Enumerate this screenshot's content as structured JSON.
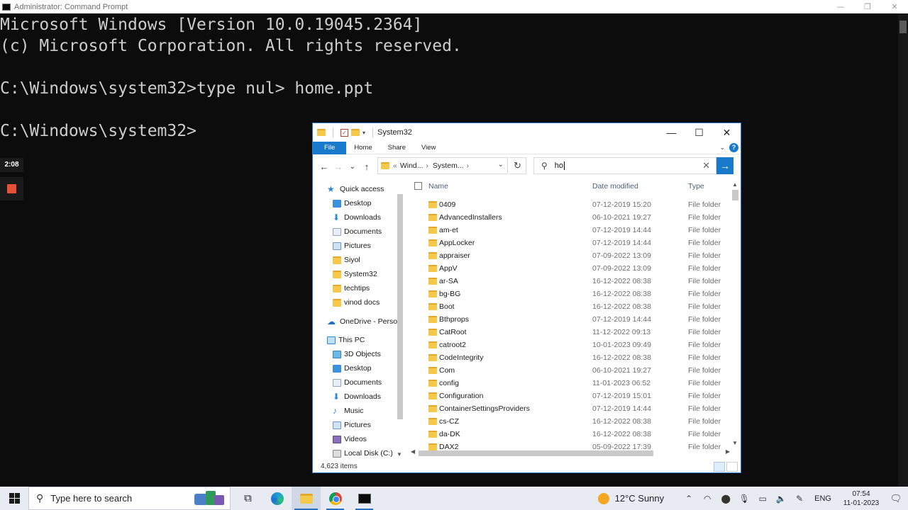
{
  "cmd": {
    "title": "Administrator: Command Prompt",
    "controls": [
      "—",
      "❐",
      "✕"
    ],
    "lines": [
      "Microsoft Windows [Version 10.0.19045.2364]",
      "(c) Microsoft Corporation. All rights reserved.",
      "",
      "C:\\Windows\\system32>type nul> home.ppt",
      "",
      "C:\\Windows\\system32>"
    ]
  },
  "recorder": {
    "timer": "2:08"
  },
  "explorer": {
    "title": "System32",
    "controls": [
      "—",
      "☐",
      "✕"
    ],
    "ribbon": {
      "tabs": [
        "File",
        "Home",
        "Share",
        "View"
      ]
    },
    "nav": {
      "back": "←",
      "forward": "→",
      "recent": "⌄",
      "up": "↑"
    },
    "address": {
      "crumbs": [
        "Wind...",
        "System..."
      ],
      "prefix": "«"
    },
    "search": {
      "value": "ho",
      "clear": "✕",
      "go": "→"
    },
    "navpane": [
      {
        "label": "Quick access",
        "icon": "star-icon",
        "pinned": false,
        "indent": 1
      },
      {
        "label": "Desktop",
        "icon": "desktop-icon",
        "pinned": true,
        "indent": 2
      },
      {
        "label": "Downloads",
        "icon": "download-icon",
        "pinned": true,
        "indent": 2
      },
      {
        "label": "Documents",
        "icon": "documents-icon",
        "pinned": true,
        "indent": 2
      },
      {
        "label": "Pictures",
        "icon": "pictures-icon",
        "pinned": true,
        "indent": 2
      },
      {
        "label": "Siyol",
        "icon": "folder-icon",
        "pinned": false,
        "indent": 2
      },
      {
        "label": "System32",
        "icon": "folder-icon",
        "pinned": false,
        "indent": 2
      },
      {
        "label": "techtips",
        "icon": "folder-icon",
        "pinned": false,
        "indent": 2
      },
      {
        "label": "vinod docs",
        "icon": "folder-icon",
        "pinned": false,
        "indent": 2
      },
      {
        "label": "OneDrive - Person",
        "icon": "onedrive-icon",
        "pinned": false,
        "indent": 1
      },
      {
        "label": "This PC",
        "icon": "pc-icon",
        "pinned": false,
        "indent": 1
      },
      {
        "label": "3D Objects",
        "icon": "3d-objects-icon",
        "pinned": false,
        "indent": 2
      },
      {
        "label": "Desktop",
        "icon": "desktop-icon",
        "pinned": false,
        "indent": 2
      },
      {
        "label": "Documents",
        "icon": "documents-icon",
        "pinned": false,
        "indent": 2
      },
      {
        "label": "Downloads",
        "icon": "download-icon",
        "pinned": false,
        "indent": 2
      },
      {
        "label": "Music",
        "icon": "music-icon",
        "pinned": false,
        "indent": 2
      },
      {
        "label": "Pictures",
        "icon": "pictures-icon",
        "pinned": false,
        "indent": 2
      },
      {
        "label": "Videos",
        "icon": "videos-icon",
        "pinned": false,
        "indent": 2
      },
      {
        "label": "Local Disk (C:)",
        "icon": "disk-icon",
        "pinned": false,
        "indent": 2
      }
    ],
    "columns": {
      "name": "Name",
      "date": "Date modified",
      "type": "Type"
    },
    "files": [
      {
        "name": "0409",
        "date": "07-12-2019 15:20",
        "type": "File folder"
      },
      {
        "name": "AdvancedInstallers",
        "date": "06-10-2021 19:27",
        "type": "File folder"
      },
      {
        "name": "am-et",
        "date": "07-12-2019 14:44",
        "type": "File folder"
      },
      {
        "name": "AppLocker",
        "date": "07-12-2019 14:44",
        "type": "File folder"
      },
      {
        "name": "appraiser",
        "date": "07-09-2022 13:09",
        "type": "File folder"
      },
      {
        "name": "AppV",
        "date": "07-09-2022 13:09",
        "type": "File folder"
      },
      {
        "name": "ar-SA",
        "date": "16-12-2022 08:38",
        "type": "File folder"
      },
      {
        "name": "bg-BG",
        "date": "16-12-2022 08:38",
        "type": "File folder"
      },
      {
        "name": "Boot",
        "date": "16-12-2022 08:38",
        "type": "File folder"
      },
      {
        "name": "Bthprops",
        "date": "07-12-2019 14:44",
        "type": "File folder"
      },
      {
        "name": "CatRoot",
        "date": "11-12-2022 09:13",
        "type": "File folder"
      },
      {
        "name": "catroot2",
        "date": "10-01-2023 09:49",
        "type": "File folder"
      },
      {
        "name": "CodeIntegrity",
        "date": "16-12-2022 08:38",
        "type": "File folder"
      },
      {
        "name": "Com",
        "date": "06-10-2021 19:27",
        "type": "File folder"
      },
      {
        "name": "config",
        "date": "11-01-2023 06:52",
        "type": "File folder"
      },
      {
        "name": "Configuration",
        "date": "07-12-2019 15:01",
        "type": "File folder"
      },
      {
        "name": "ContainerSettingsProviders",
        "date": "07-12-2019 14:44",
        "type": "File folder"
      },
      {
        "name": "cs-CZ",
        "date": "16-12-2022 08:38",
        "type": "File folder"
      },
      {
        "name": "da-DK",
        "date": "16-12-2022 08:38",
        "type": "File folder"
      },
      {
        "name": "DAX2",
        "date": "05-09-2022 17:39",
        "type": "File folder"
      }
    ],
    "status": "4,623 items"
  },
  "taskbar": {
    "search_placeholder": "Type here to search",
    "weather": "12°C  Sunny",
    "language": "ENG",
    "time": "07:54",
    "date": "11-01-2023"
  }
}
